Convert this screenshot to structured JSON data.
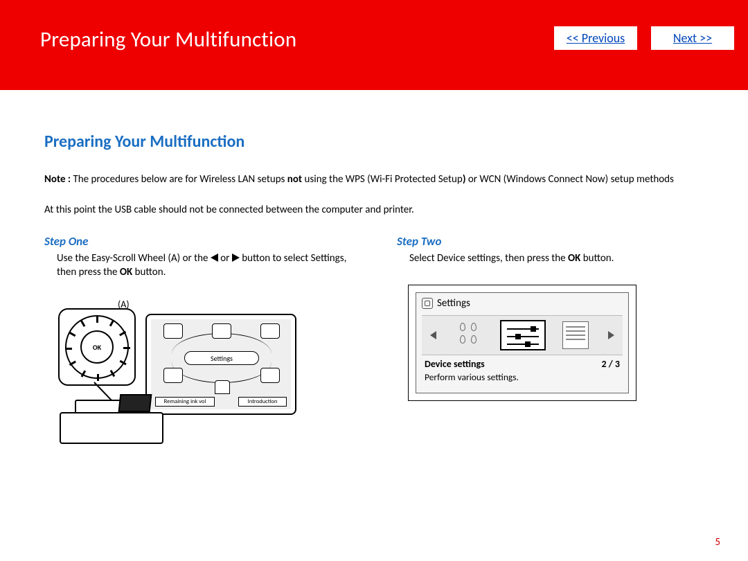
{
  "header": {
    "title": "Preparing Your Multifunction",
    "prev_label": "<< Previous",
    "next_label": "Next >>"
  },
  "section": {
    "heading": "Preparing Your Multifunction",
    "note_prefix": "Note :",
    "note_part1": " The procedures below are for Wireless LAN setups ",
    "note_bold1": "not",
    "note_part2": " using the WPS (Wi-Fi Protected Setup",
    "note_bold2": ")",
    "note_part3": " or WCN (Windows Connect Now) setup methods",
    "intro": "At this point the USB cable should not be connected between the computer and printer."
  },
  "steps": {
    "one": {
      "label": "Step One",
      "t1": "Use the Easy-Scroll Wheel (A) or the ",
      "t2": " or ",
      "t3": " button to select Settings, then press the ",
      "t_ok": "OK",
      "t4": " button."
    },
    "two": {
      "label": "Step Two",
      "t1": "Select Device settings, then press the ",
      "t_ok": "OK",
      "t2": " button."
    }
  },
  "illus": {
    "one": {
      "callout": "(A)",
      "ok": "OK",
      "center_label": "Settings",
      "bottom_left": "Remaining ink vol",
      "bottom_right": "Introduction"
    },
    "two": {
      "title": "Settings",
      "selected": "Device settings",
      "count": "2 / 3",
      "desc": "Perform various settings."
    }
  },
  "page_number": "5"
}
